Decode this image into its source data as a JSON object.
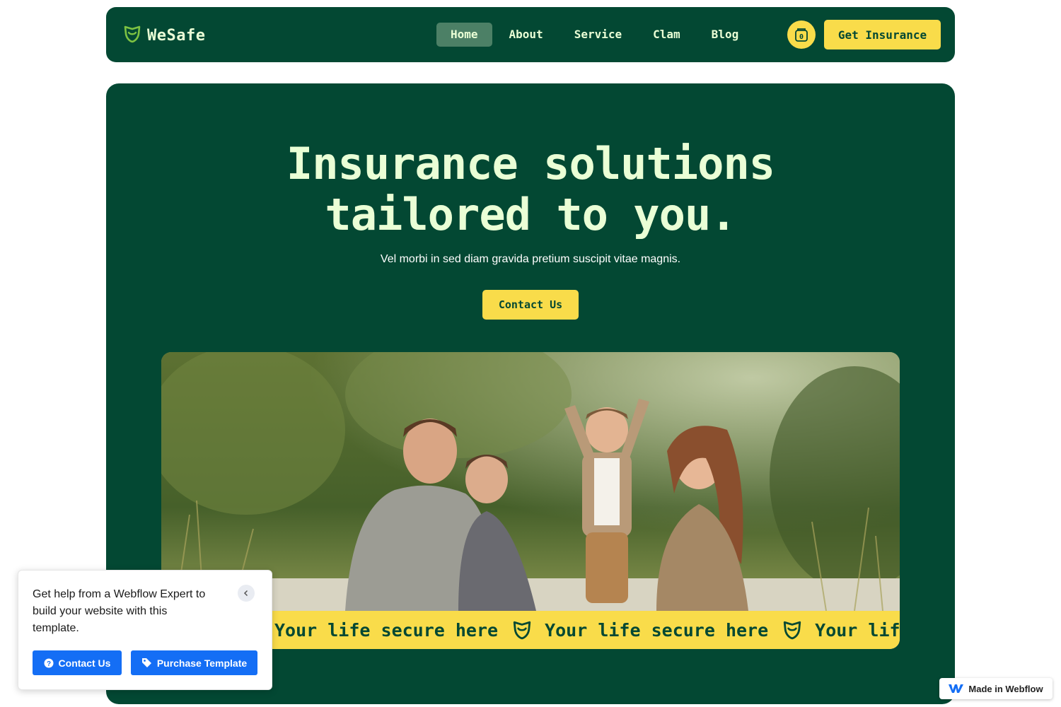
{
  "nav": {
    "logo_text": "WeSafe",
    "links": [
      {
        "label": "Home",
        "active": true
      },
      {
        "label": "About",
        "active": false
      },
      {
        "label": "Service",
        "active": false
      },
      {
        "label": "Clam",
        "active": false
      },
      {
        "label": "Blog",
        "active": false
      }
    ],
    "cart_count": "0",
    "cta_label": "Get Insurance"
  },
  "hero": {
    "title_line1": "Insurance solutions",
    "title_line2": "tailored to you.",
    "subtitle": "Vel morbi in sed diam gravida pretium suscipit vitae magnis.",
    "button_label": "Contact Us",
    "image_icon": "family-photo",
    "marquee_text": "Your life secure here",
    "marquee_icon": "shield-icon"
  },
  "help_popup": {
    "text": "Get help from a Webflow Expert to build your website with this template.",
    "contact_label": "Contact Us",
    "purchase_label": "Purchase Template"
  },
  "badge": {
    "label": "Made in Webflow"
  },
  "colors": {
    "primary": "#034833",
    "accent": "#F9DC4A",
    "text_light": "#EAFFD6",
    "nav_active": "#4C8066",
    "webflow_blue": "#146EF5"
  }
}
